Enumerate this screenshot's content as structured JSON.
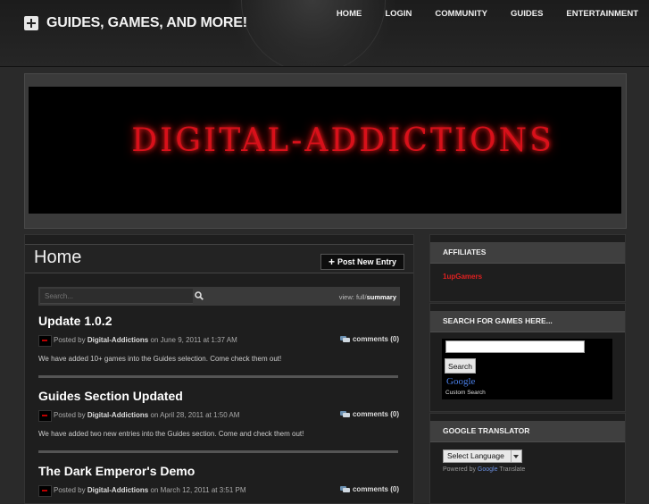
{
  "header": {
    "site_title": "GUIDES, GAMES, AND MORE!",
    "nav": [
      "HOME",
      "LOGIN",
      "COMMUNITY",
      "GUIDES",
      "ENTERTAINMENT"
    ]
  },
  "banner": {
    "text": "DIGITAL-ADDICTIONS"
  },
  "main": {
    "title": "Home",
    "post_button": "Post New Entry",
    "search_placeholder": "Search...",
    "view_label": "view:",
    "view_full": "full",
    "view_sep": "/",
    "view_summary": "summary",
    "posts": [
      {
        "title": "Update 1.0.2",
        "by": "Posted by",
        "author": "Digital-Addictions",
        "date": "on June 9, 2011 at 1:37 AM",
        "comments": "comments (0)",
        "excerpt": "We have added 10+ games into the Guides selection. Come check them out!"
      },
      {
        "title": "Guides Section Updated",
        "by": "Posted by",
        "author": "Digital-Addictions",
        "date": "on April 28, 2011 at 1:50 AM",
        "comments": "comments (0)",
        "excerpt": "We have added two new entries into the Guides section. Come and check them out!"
      },
      {
        "title": "The Dark Emperor's Demo",
        "by": "Posted by",
        "author": "Digital-Addictions",
        "date": "on March 12, 2011 at 3:51 PM",
        "comments": "comments (0)",
        "excerpt": ""
      }
    ]
  },
  "sidebar": {
    "affiliates": {
      "title": "AFFILIATES",
      "link": "1upGamers"
    },
    "search_games": {
      "title": "SEARCH FOR GAMES HERE...",
      "button": "Search",
      "caption": "Custom Search",
      "google": "Google"
    },
    "translator": {
      "title": "GOOGLE TRANSLATOR",
      "select": "Select Language",
      "powered_by": "Powered by",
      "translate": "Translate",
      "google": "Google"
    }
  },
  "colors": {
    "accent_red": "#e02020",
    "banner_red": "#d8101a"
  }
}
